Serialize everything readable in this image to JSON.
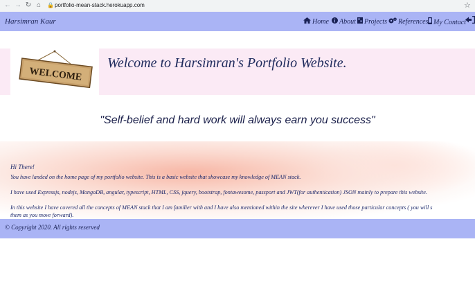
{
  "browser": {
    "url": "portfolio-mean-stack.herokuapp.com"
  },
  "navbar": {
    "brand": "Harsimran Kaur",
    "items": [
      {
        "label": "Home",
        "icon": "home-icon"
      },
      {
        "label": "About",
        "icon": "info-icon"
      },
      {
        "label": "Projects",
        "icon": "projects-icon"
      },
      {
        "label": "References",
        "icon": "gears-icon"
      },
      {
        "label": "My Contact",
        "icon": "mobile-icon"
      },
      {
        "label": "",
        "icon": "logout-icon"
      }
    ]
  },
  "welcome": {
    "sign_text": "WELCOME",
    "title": "Welcome to Harsimran's Portfolio Website."
  },
  "quote": "\"Self-belief and hard work will always earn you success\"",
  "intro": {
    "greeting": "Hi There!",
    "para1": "You have landed on the home page of my portfolio website. This is a basic website that showcase my knowledge of MEAN stack.",
    "para2": "I have used Expressjs, nodejs, MongoDB, angular, typescript, HTML, CSS, jquery, bootstrap, fontawesome, passport and JWT(for authentication) JSON mainly to prepare this website.",
    "para3_line1": "In this website I have covered all the concepts of MEAN stack that I am familier with and I have also mentioned within the site wherever I have used those particular concepts ( you will s",
    "para3_line2": "them as you move forward)."
  },
  "footer": {
    "copyright": "© Copyright 2020. All rights reserved"
  }
}
